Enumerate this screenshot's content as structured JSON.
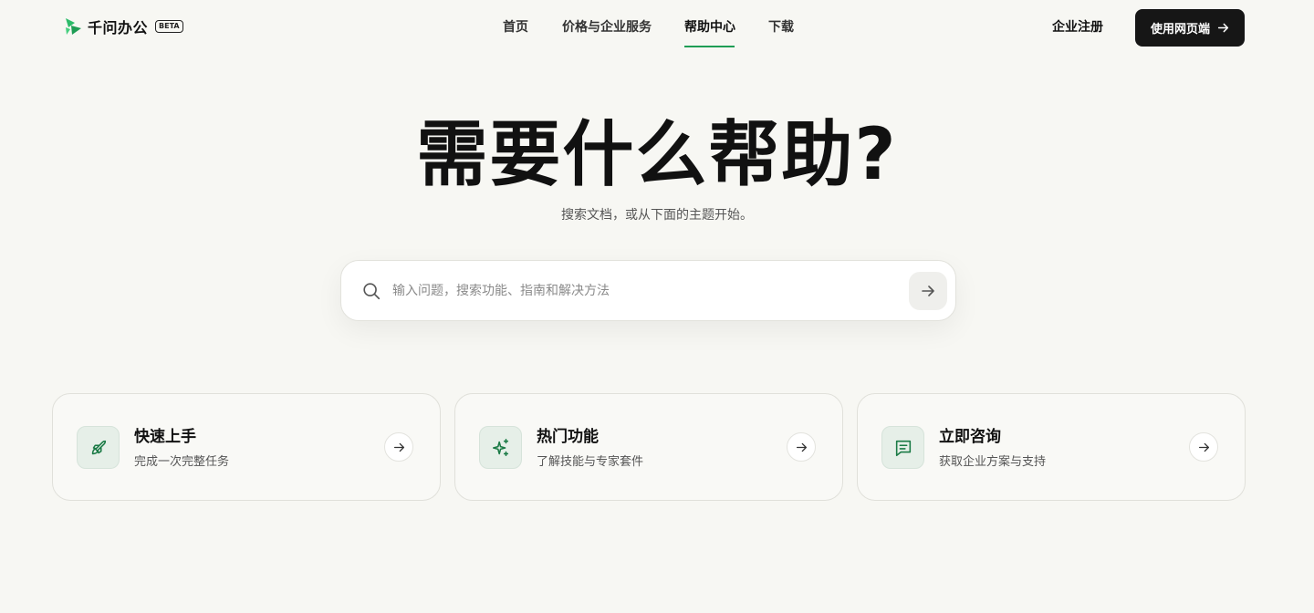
{
  "header": {
    "logo_text": "千问办公",
    "beta_label": "BETA",
    "nav": [
      {
        "label": "首页"
      },
      {
        "label": "价格与企业服务"
      },
      {
        "label": "帮助中心"
      },
      {
        "label": "下载"
      }
    ],
    "active_nav": "帮助中心",
    "register_label": "企业注册",
    "web_button_label": "使用网页端"
  },
  "hero": {
    "title": "需要什么帮助?",
    "subtitle": "搜索文档，或从下面的主题开始。"
  },
  "search": {
    "placeholder": "输入问题，搜索功能、指南和解决方法",
    "value": ""
  },
  "cards": [
    {
      "title": "快速上手",
      "description": "完成一次完整任务",
      "icon": "rocket-icon"
    },
    {
      "title": "热门功能",
      "description": "了解技能与专家套件",
      "icon": "sparkles-icon"
    },
    {
      "title": "立即咨询",
      "description": "获取企业方案与支持",
      "icon": "message-icon"
    }
  ],
  "colors": {
    "background": "#f7f7f3",
    "accent": "#1f9d55",
    "icon_green": "#1a7a45",
    "primary_button": "#161616"
  }
}
